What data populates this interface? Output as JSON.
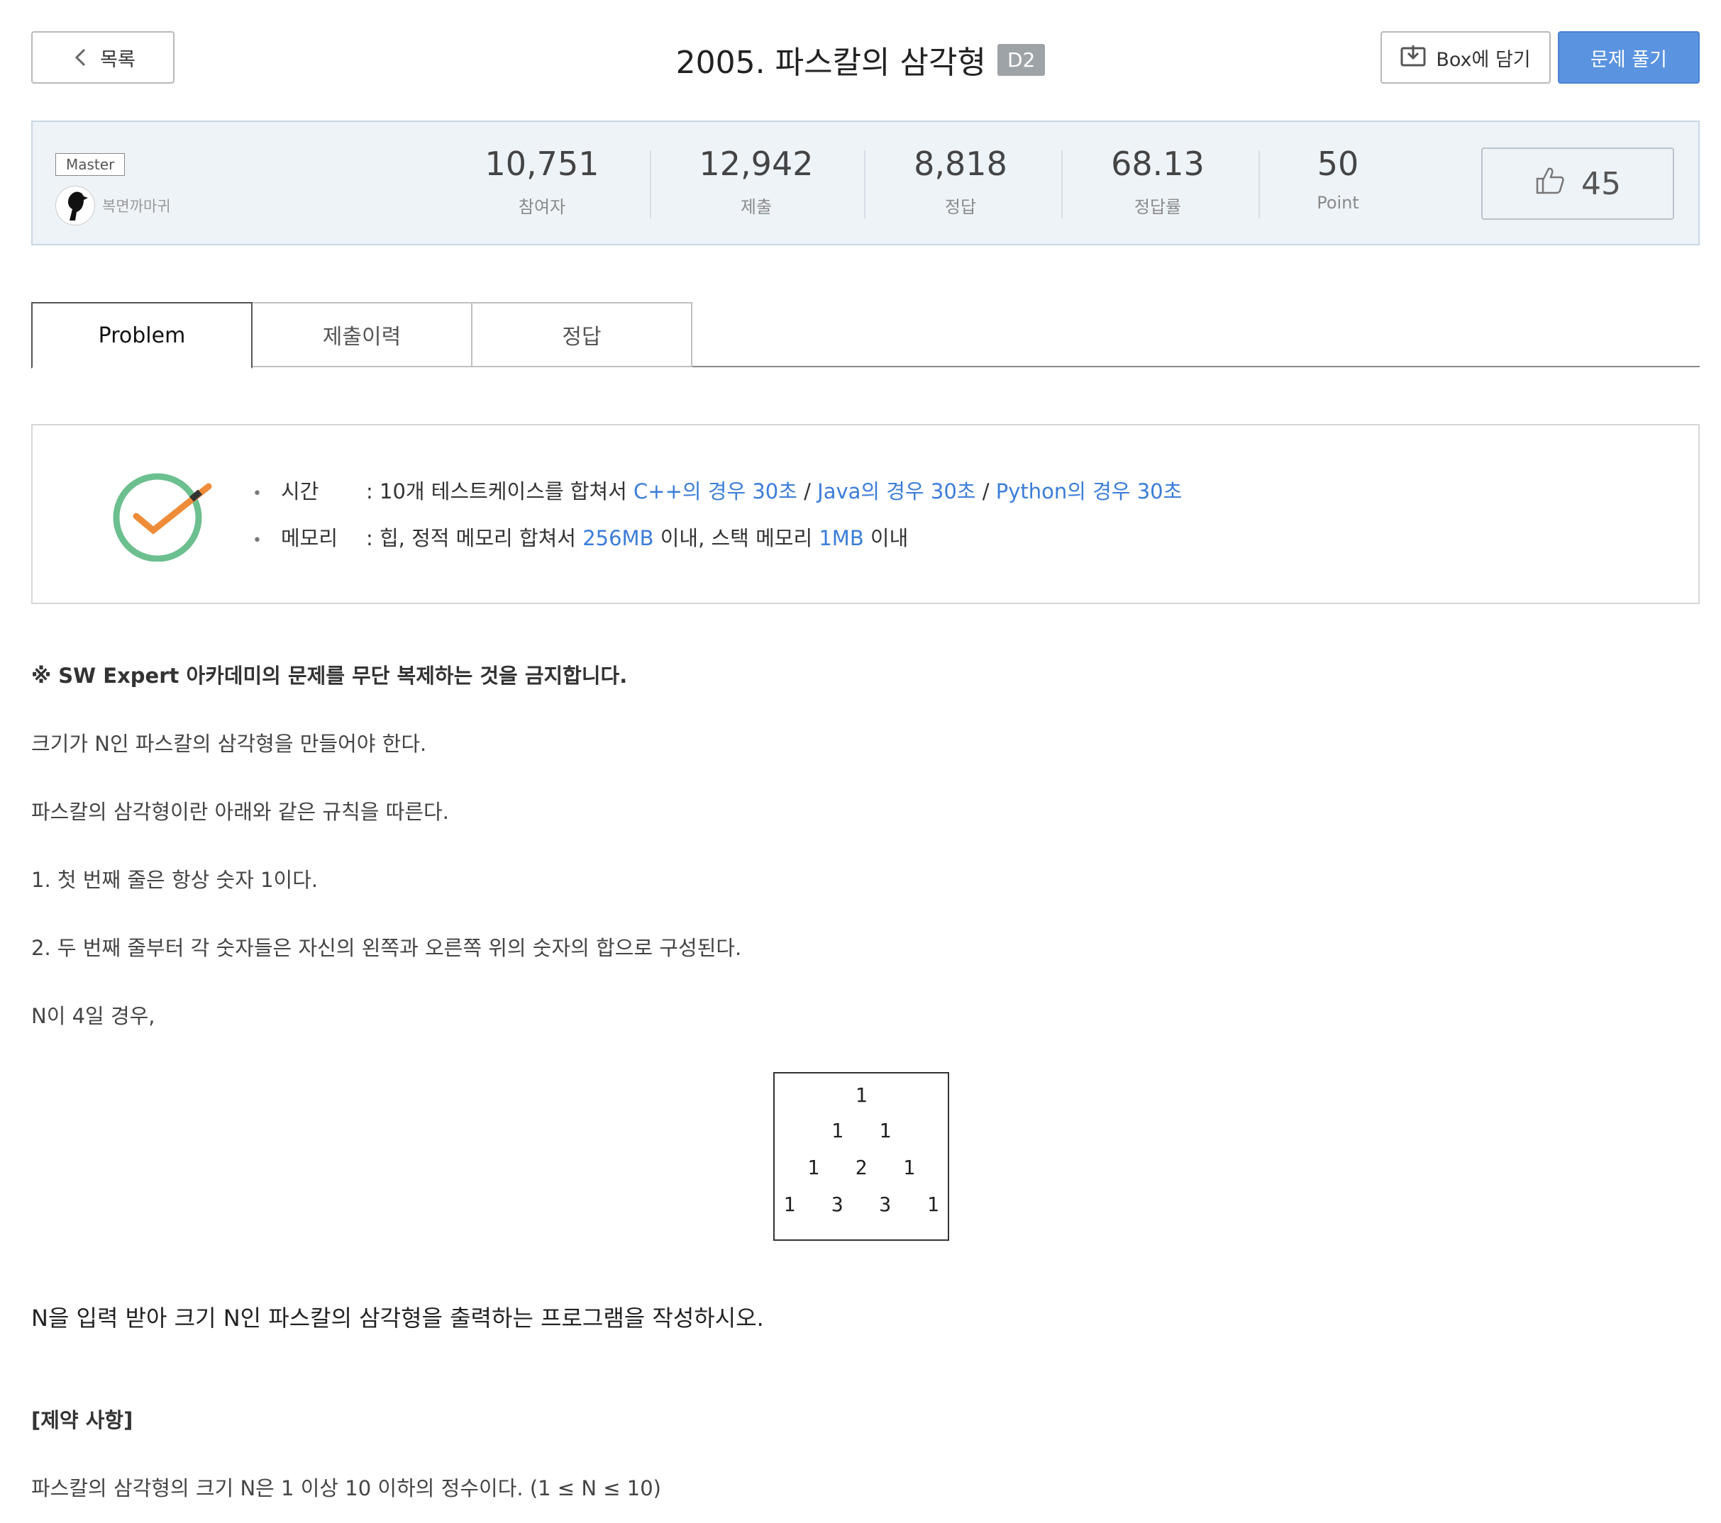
{
  "header": {
    "back_label": "목록",
    "title": "2005. 파스칼의 삼각형",
    "level": "D2",
    "box_label": "Box에 담기",
    "solve_label": "문제 풀기"
  },
  "stats": {
    "author_rank": "Master",
    "author_name": "복면까마귀",
    "items": [
      {
        "value": "10,751",
        "label": "참여자"
      },
      {
        "value": "12,942",
        "label": "제출"
      },
      {
        "value": "8,818",
        "label": "정답"
      },
      {
        "value": "68.13",
        "label": "정답률"
      },
      {
        "value": "50",
        "label": "Point"
      }
    ],
    "likes": "45"
  },
  "tabs": [
    "Problem",
    "제출이력",
    "정답"
  ],
  "limits": {
    "time_key": "시간",
    "time_prefix": ": 10개 테스트케이스를 합쳐서 ",
    "time_cpp": "C++의 경우 30초",
    "slash1": " / ",
    "time_java": "Java의 경우 30초",
    "slash2": " / ",
    "time_python": "Python의 경우 30초",
    "memory_key": "메모리",
    "memory_prefix": ": 힙, 정적 메모리 합쳐서 ",
    "memory_heap": "256MB",
    "memory_mid": " 이내, 스택 메모리 ",
    "memory_stack": "1MB",
    "memory_suffix": " 이내"
  },
  "problem": {
    "notice": "※ SW Expert 아카데미의 문제를 무단 복제하는 것을 금지합니다.",
    "p1": "크기가 N인 파스칼의 삼각형을 만들어야 한다.",
    "p2": "파스칼의 삼각형이란 아래와 같은 규칙을 따른다.",
    "p3": "1. 첫 번째 줄은 항상 숫자 1이다.",
    "p4": "2. 두 번째 줄부터 각 숫자들은 자신의 왼쪽과 오른쪽 위의 숫자의 합으로 구성된다.",
    "p5": "N이 4일 경우,",
    "triangle": [
      "1",
      "1   1",
      "1   2   1",
      "1   3   3   1"
    ],
    "p6": "N을 입력 받아 크기 N인 파스칼의 삼각형을 출력하는 프로그램을 작성하시오.",
    "constraint_title": "[제약 사항]",
    "constraint_text": "파스칼의 삼각형의 크기 N은 1 이상 10 이하의 정수이다. (1 ≤ N ≤ 10)"
  }
}
